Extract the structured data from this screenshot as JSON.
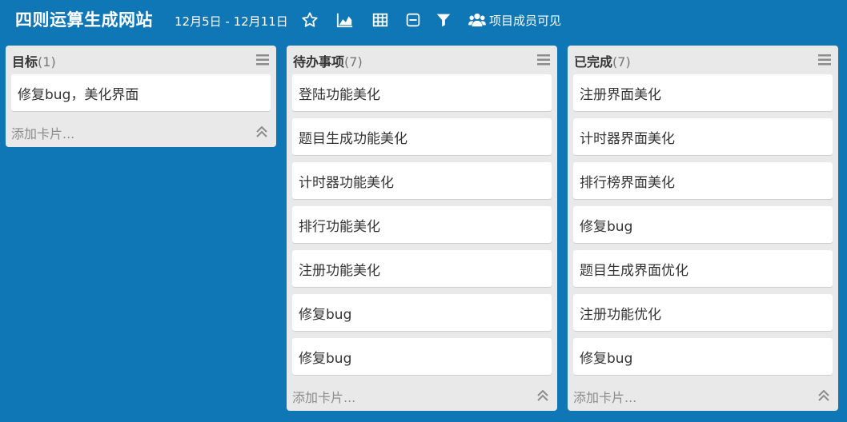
{
  "theme": {
    "board_bg": "#0f77b5",
    "list_bg": "#e9e9e9",
    "card_bg": "#ffffff"
  },
  "header": {
    "board_title": "四则运算生成网站",
    "date_range": "12月5日 - 12月11日",
    "icons": [
      "star-icon",
      "chart-icon",
      "table-icon",
      "collapse-box-icon",
      "filter-icon",
      "team-icon"
    ],
    "visibility_label": "项目成员可见"
  },
  "lists": [
    {
      "title": "目标",
      "count": "(1)",
      "cards": [
        "修复bug，美化界面"
      ],
      "add_card": "添加卡片..."
    },
    {
      "title": "待办事项",
      "count": "(7)",
      "cards": [
        "登陆功能美化",
        "题目生成功能美化",
        "计时器功能美化",
        "排行功能美化",
        "注册功能美化",
        "修复bug",
        "修复bug"
      ],
      "add_card": "添加卡片..."
    },
    {
      "title": "已完成",
      "count": "(7)",
      "cards": [
        "注册界面美化",
        "计时器界面美化",
        "排行榜界面美化",
        "修复bug",
        "题目生成界面优化",
        "注册功能优化",
        "修复bug"
      ],
      "add_card": "添加卡片..."
    }
  ]
}
